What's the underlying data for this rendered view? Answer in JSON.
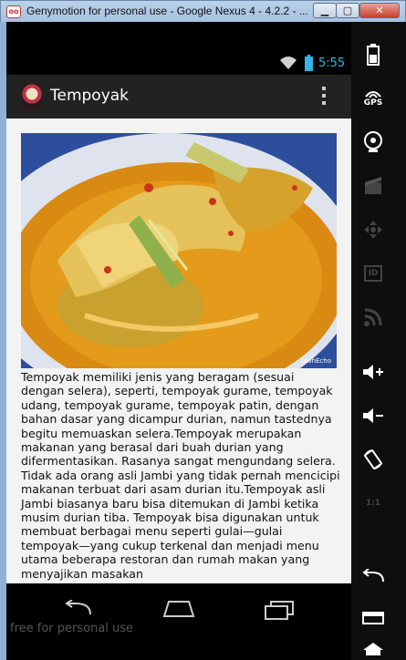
{
  "window": {
    "title": "Genymotion for personal use - Google Nexus 4 - 4.2.2 - ...",
    "icon_label": "oo",
    "minimize_label": "▁",
    "maximize_label": "▢",
    "close_label": "✕"
  },
  "status_bar": {
    "time": "5:55",
    "wifi_icon": "wifi-icon",
    "battery_icon": "battery-charging-icon"
  },
  "action_bar": {
    "title": "Tempoyak",
    "logo_icon": "app-logo",
    "menu_icon": "overflow-menu-icon"
  },
  "content": {
    "image_watermark": "IpohEcho",
    "article_text": "Tempoyak memiliki jenis yang beragam (sesuai dengan selera), seperti, tempoyak gurame, tempoyak udang, tempoyak gurame, tempoyak patin, dengan bahan dasar yang dicampur durian, namun tastednya begitu memuaskan selera.Tempoyak merupakan makanan yang berasal dari buah durian yang difermentasikan. Rasanya sangat mengundang selera. Tidak ada orang asli Jambi yang tidak pernah mencicipi makanan terbuat dari asam durian itu.Tempoyak asli Jambi biasanya baru bisa ditemukan di Jambi ketika musim durian tiba. Tempoyak bisa digunakan untuk membuat berbagai menu seperti gulai—gulai tempoyak—yang cukup terkenal dan menjadi menu utama beberapa restoran dan rumah makan yang menyajikan masakan"
  },
  "nav_bar": {
    "back_icon": "back-icon",
    "home_icon": "home-icon",
    "recents_icon": "recent-apps-icon",
    "overlay_text": "free for personal use"
  },
  "toolbar": {
    "gps_label": "GPS",
    "id_label": "ID",
    "pixel_label": "1:1",
    "items": [
      "battery-icon",
      "gps-icon",
      "webcam-icon",
      "screencast-icon",
      "dpad-icon",
      "device-id-icon",
      "rss-icon",
      "volume-up-icon",
      "volume-down-icon",
      "rotate-icon",
      "pixel-perfect-icon",
      "back-icon",
      "menu-icon",
      "home-icon"
    ]
  }
}
